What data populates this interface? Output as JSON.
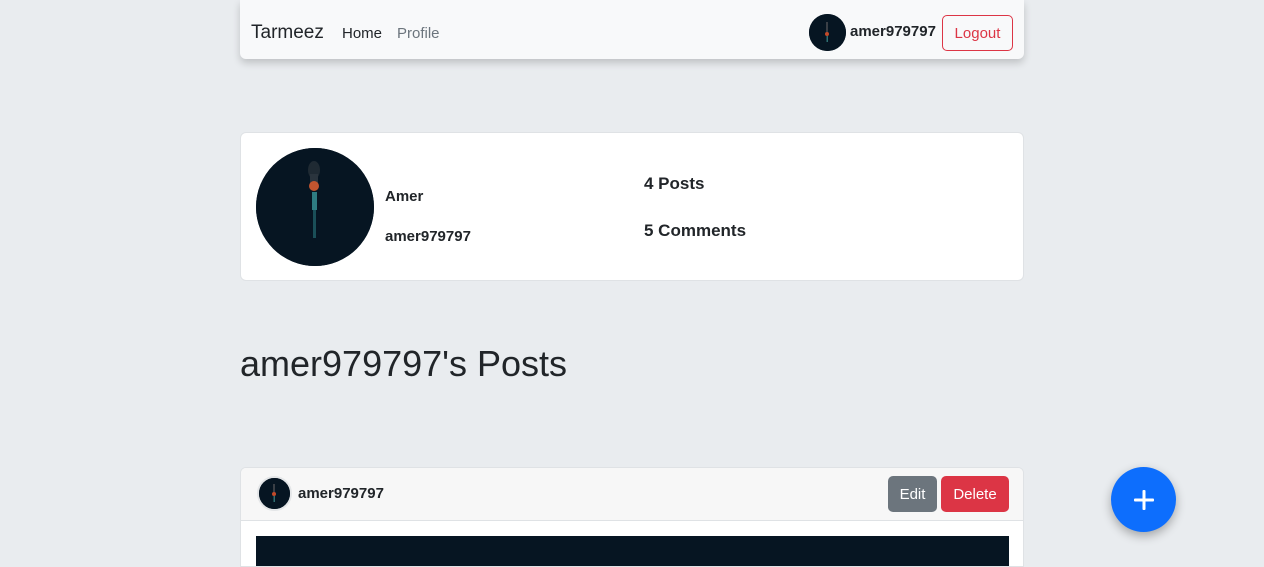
{
  "navbar": {
    "brand": "Tarmeez",
    "links": [
      {
        "label": "Home"
      },
      {
        "label": "Profile"
      }
    ],
    "username": "amer979797",
    "logout_label": "Logout"
  },
  "profile": {
    "name": "Amer",
    "username": "amer979797",
    "posts_count": "4 Posts",
    "comments_count": "5 Comments"
  },
  "posts_section": {
    "title": "amer979797's Posts"
  },
  "post": {
    "username": "amer979797",
    "edit_label": "Edit",
    "delete_label": "Delete"
  },
  "fab": {
    "icon": "plus-icon"
  },
  "colors": {
    "background": "#e9ecef",
    "primary": "#0d6efd",
    "danger": "#dc3545",
    "secondary": "#6c757d",
    "image_dark": "#061522"
  }
}
